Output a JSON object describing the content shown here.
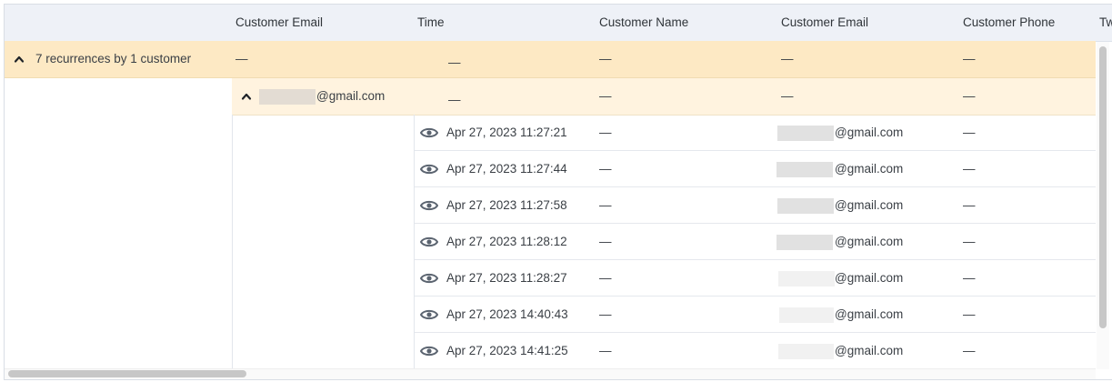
{
  "columns": {
    "customer_email": "Customer Email",
    "time": "Time",
    "customer_name": "Customer Name",
    "customer_email_2": "Customer Email",
    "customer_phone": "Customer Phone",
    "truncated": "Tw"
  },
  "group": {
    "label": "7 recurrences by 1 customer",
    "email_cell": "—",
    "time_cell": "—",
    "name_cell": "—",
    "email2_cell": "—",
    "phone_cell": "—"
  },
  "subgroup": {
    "email_domain": "@gmail.com",
    "time_cell": "—",
    "name_cell": "—",
    "email2_cell": "—",
    "phone_cell": "—"
  },
  "rows": [
    {
      "time": "Apr 27, 2023 11:27:21",
      "name": "—",
      "email_domain": "@gmail.com",
      "phone": "—"
    },
    {
      "time": "Apr 27, 2023 11:27:44",
      "name": "—",
      "email_domain": "@gmail.com",
      "phone": "—"
    },
    {
      "time": "Apr 27, 2023 11:27:58",
      "name": "—",
      "email_domain": "@gmail.com",
      "phone": "—"
    },
    {
      "time": "Apr 27, 2023 11:28:12",
      "name": "—",
      "email_domain": "@gmail.com",
      "phone": "—"
    },
    {
      "time": "Apr 27, 2023 11:28:27",
      "name": "—",
      "email_domain": "@gmail.com",
      "phone": "—"
    },
    {
      "time": "Apr 27, 2023 14:40:43",
      "name": "—",
      "email_domain": "@gmail.com",
      "phone": "—"
    },
    {
      "time": "Apr 27, 2023 14:41:25",
      "name": "—",
      "email_domain": "@gmail.com",
      "phone": "—"
    }
  ],
  "icons": {
    "expand_group": "chevron-up-icon",
    "view_row": "eye-icon"
  },
  "colors": {
    "header_bg": "#eef1f7",
    "group_bg": "#fde9c4",
    "subgroup_bg": "#fff3df",
    "icon": "#5b6470"
  }
}
